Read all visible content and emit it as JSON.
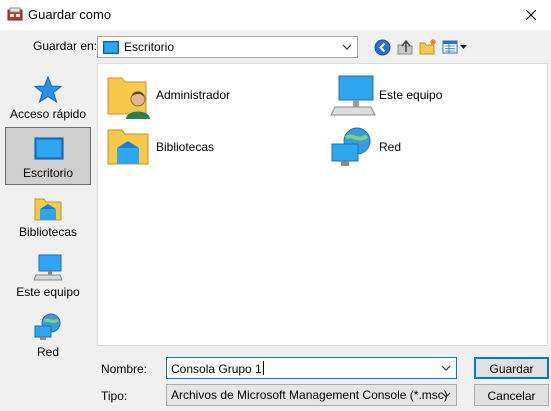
{
  "window": {
    "title": "Guardar como"
  },
  "lookin": {
    "label": "Guardar en:",
    "value": "Escritorio"
  },
  "toolbar": {
    "icons": [
      "back-icon",
      "up-folder-icon",
      "new-folder-icon",
      "view-menu-icon"
    ]
  },
  "places": [
    {
      "label": "Acceso rápido",
      "icon": "star-icon",
      "selected": false
    },
    {
      "label": "Escritorio",
      "icon": "desktop-icon",
      "selected": true
    },
    {
      "label": "Bibliotecas",
      "icon": "libraries-icon",
      "selected": false
    },
    {
      "label": "Este equipo",
      "icon": "computer-icon",
      "selected": false
    },
    {
      "label": "Red",
      "icon": "network-icon",
      "selected": false
    }
  ],
  "files": [
    {
      "label": "Administrador",
      "icon": "user-folder-icon"
    },
    {
      "label": "Este equipo",
      "icon": "computer-icon"
    },
    {
      "label": "Bibliotecas",
      "icon": "libraries-icon"
    },
    {
      "label": "Red",
      "icon": "network-icon"
    }
  ],
  "filename": {
    "label": "Nombre:",
    "value": "Consola Grupo 1"
  },
  "filetype": {
    "label": "Tipo:",
    "value": "Archivos de Microsoft Management Console (*.msc)"
  },
  "buttons": {
    "save": "Guardar",
    "cancel": "Cancelar"
  },
  "colors": {
    "accent": "#0078d7",
    "selection": "#cfcfcf",
    "folder": "#f6c94a"
  }
}
